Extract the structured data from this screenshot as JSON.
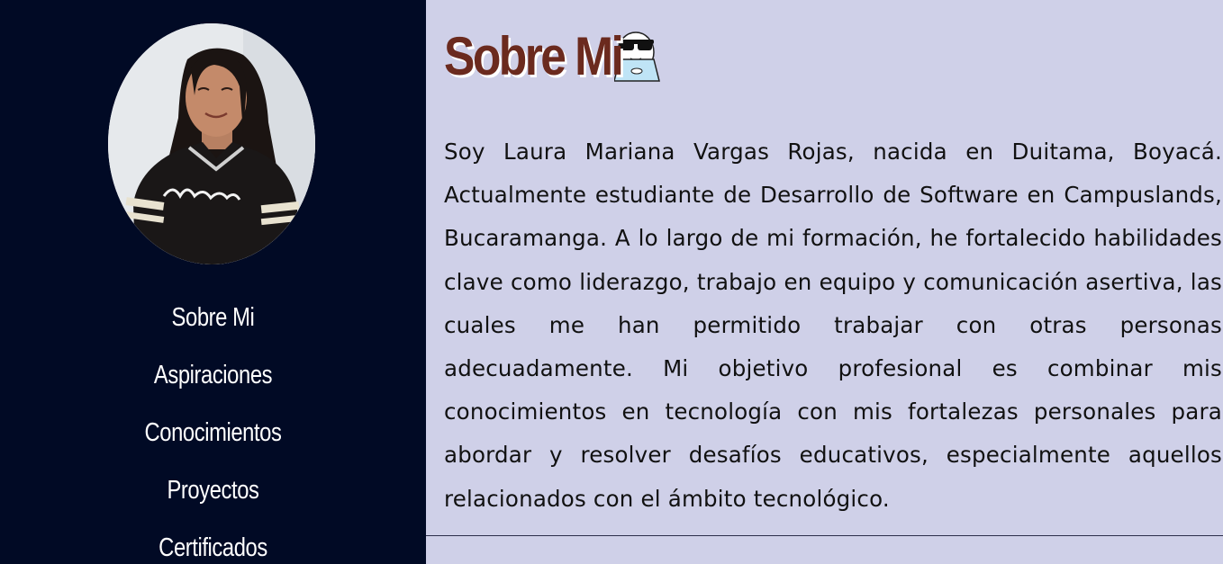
{
  "sidebar": {
    "nav_items": [
      {
        "label": "Sobre Mi"
      },
      {
        "label": "Aspiraciones"
      },
      {
        "label": "Conocimientos"
      },
      {
        "label": "Proyectos"
      },
      {
        "label": "Certificados"
      }
    ]
  },
  "main": {
    "title": "Sobre Mi",
    "title_icon": "cool-laptop-emoji-icon",
    "bio": "Soy Laura Mariana Vargas Rojas, nacida en Duitama, Boyacá. Actualmente estudiante de Desarrollo de Software en Campuslands, Bucaramanga. A lo largo de mi formación, he fortalecido habilidades clave como liderazgo, trabajo en equipo y comunicación asertiva, las cuales me han permitido trabajar con otras personas adecuadamente. Mi objetivo profesional es combinar mis conocimientos en tecnología con mis fortalezas personales para abordar y resolver desafíos educativos, especialmente aquellos relacionados con el ámbito tecnológico."
  },
  "colors": {
    "sidebar_bg": "#010a25",
    "main_bg": "#cfd0e8",
    "title_color": "#6b2a1e",
    "nav_text": "#ffffff"
  }
}
